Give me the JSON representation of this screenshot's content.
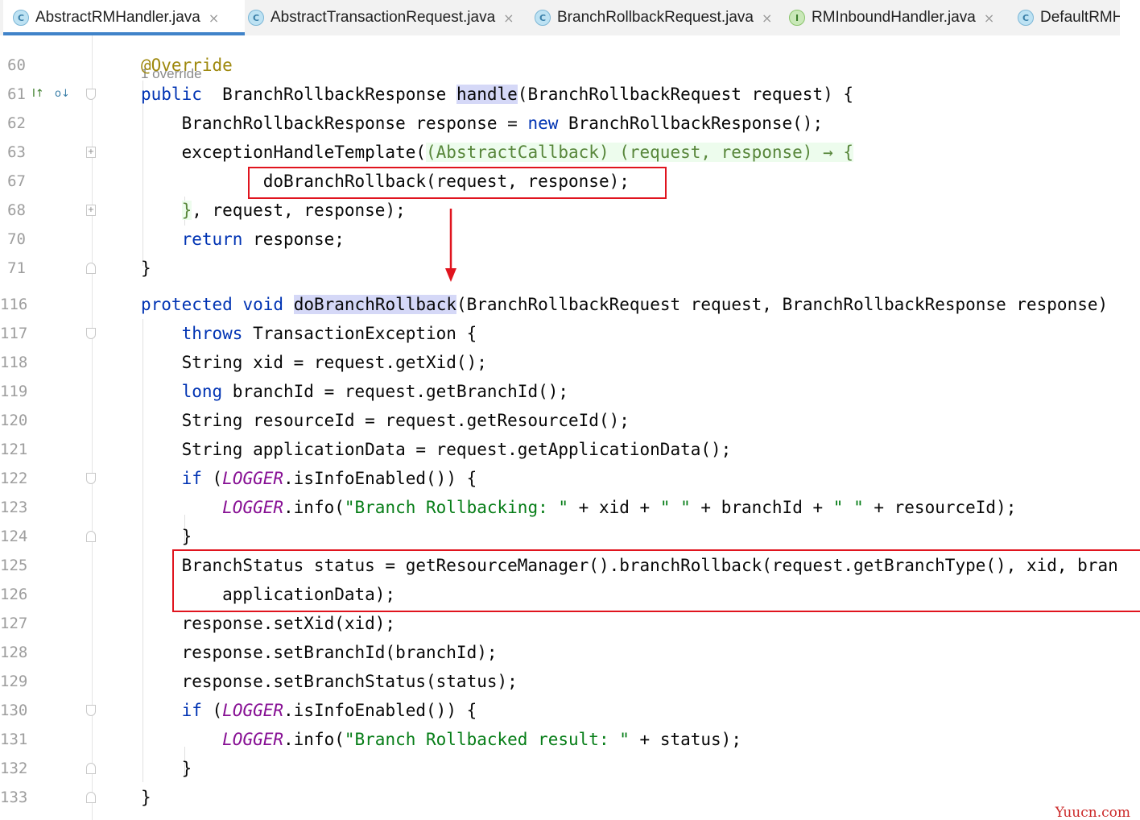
{
  "tabs": [
    {
      "label": "AbstractRMHandler.java",
      "type": "C",
      "active": true,
      "closable": true
    },
    {
      "label": "AbstractTransactionRequest.java",
      "type": "C",
      "active": false,
      "closable": true
    },
    {
      "label": "BranchRollbackRequest.java",
      "type": "C",
      "active": false,
      "closable": true
    },
    {
      "label": "RMInboundHandler.java",
      "type": "I",
      "active": false,
      "closable": true
    },
    {
      "label": "DefaultRMH",
      "type": "C",
      "active": false,
      "closable": false
    }
  ],
  "usage_hint": "1 override",
  "lines": [
    {
      "n": "60",
      "fold": "",
      "code": [
        [
          "an",
          "@Override"
        ]
      ]
    },
    {
      "n": "61",
      "fold": "down",
      "code": [
        [
          "kw",
          "public"
        ],
        [
          "",
          "  BranchRollbackResponse "
        ],
        [
          "hl",
          "handle"
        ],
        [
          "",
          "(BranchRollbackRequest request) {"
        ]
      ]
    },
    {
      "n": "62",
      "fold": "",
      "code": [
        [
          "",
          "    BranchRollbackResponse response = "
        ],
        [
          "kw",
          "new"
        ],
        [
          "",
          " BranchRollbackResponse();"
        ]
      ]
    },
    {
      "n": "63",
      "fold": "plus",
      "code": [
        [
          "",
          "    exceptionHandleTemplate("
        ],
        [
          "lamt",
          "(AbstractCallback) (request, response) → {"
        ]
      ]
    },
    {
      "n": "67",
      "fold": "",
      "code": [
        [
          "",
          "            doBranchRollback(request, response);"
        ]
      ]
    },
    {
      "n": "68",
      "fold": "plus",
      "code": [
        [
          "",
          "    "
        ],
        [
          "lamt",
          "}"
        ],
        [
          "",
          ", request, response);"
        ]
      ]
    },
    {
      "n": "70",
      "fold": "",
      "code": [
        [
          "",
          "    "
        ],
        [
          "kw",
          "return"
        ],
        [
          "",
          " response;"
        ]
      ]
    },
    {
      "n": "71",
      "fold": "up",
      "code": [
        [
          "",
          "}"
        ]
      ]
    },
    {
      "n": "116",
      "fold": "",
      "code": [
        [
          "kw",
          "protected"
        ],
        [
          "",
          " "
        ],
        [
          "kw",
          "void"
        ],
        [
          "",
          " "
        ],
        [
          "hl",
          "doBranchRollback"
        ],
        [
          "",
          "(BranchRollbackRequest request, BranchRollbackResponse response)"
        ]
      ]
    },
    {
      "n": "117",
      "fold": "down",
      "code": [
        [
          "",
          "    "
        ],
        [
          "kw",
          "throws"
        ],
        [
          "",
          " TransactionException {"
        ]
      ]
    },
    {
      "n": "118",
      "fold": "",
      "code": [
        [
          "",
          "    String xid = request.getXid();"
        ]
      ]
    },
    {
      "n": "119",
      "fold": "",
      "code": [
        [
          "",
          "    "
        ],
        [
          "kw",
          "long"
        ],
        [
          "",
          " branchId = request.getBranchId();"
        ]
      ]
    },
    {
      "n": "120",
      "fold": "",
      "code": [
        [
          "",
          "    String resourceId = request.getResourceId();"
        ]
      ]
    },
    {
      "n": "121",
      "fold": "",
      "code": [
        [
          "",
          "    String applicationData = request.getApplicationData();"
        ]
      ]
    },
    {
      "n": "122",
      "fold": "down",
      "code": [
        [
          "",
          "    "
        ],
        [
          "kw",
          "if"
        ],
        [
          "",
          " ("
        ],
        [
          "fi",
          "LOGGER"
        ],
        [
          "",
          ".isInfoEnabled()) {"
        ]
      ]
    },
    {
      "n": "123",
      "fold": "",
      "code": [
        [
          "",
          "        "
        ],
        [
          "fi",
          "LOGGER"
        ],
        [
          "",
          ".info("
        ],
        [
          "st",
          "\"Branch Rollbacking: \""
        ],
        [
          "",
          " + xid + "
        ],
        [
          "st",
          "\" \""
        ],
        [
          "",
          " + branchId + "
        ],
        [
          "st",
          "\" \""
        ],
        [
          "",
          " + resourceId);"
        ]
      ]
    },
    {
      "n": "124",
      "fold": "up",
      "code": [
        [
          "",
          "    }"
        ]
      ]
    },
    {
      "n": "125",
      "fold": "",
      "code": [
        [
          "",
          "    BranchStatus status = getResourceManager().branchRollback(request.getBranchType(), xid, bran"
        ]
      ]
    },
    {
      "n": "126",
      "fold": "",
      "code": [
        [
          "",
          "        applicationData);"
        ]
      ]
    },
    {
      "n": "127",
      "fold": "",
      "code": [
        [
          "",
          "    response.setXid(xid);"
        ]
      ]
    },
    {
      "n": "128",
      "fold": "",
      "code": [
        [
          "",
          "    response.setBranchId(branchId);"
        ]
      ]
    },
    {
      "n": "129",
      "fold": "",
      "code": [
        [
          "",
          "    response.setBranchStatus(status);"
        ]
      ]
    },
    {
      "n": "130",
      "fold": "down",
      "code": [
        [
          "",
          "    "
        ],
        [
          "kw",
          "if"
        ],
        [
          "",
          " ("
        ],
        [
          "fi",
          "LOGGER"
        ],
        [
          "",
          ".isInfoEnabled()) {"
        ]
      ]
    },
    {
      "n": "131",
      "fold": "",
      "code": [
        [
          "",
          "        "
        ],
        [
          "fi",
          "LOGGER"
        ],
        [
          "",
          ".info("
        ],
        [
          "st",
          "\"Branch Rollbacked result: \""
        ],
        [
          "",
          " + status);"
        ]
      ]
    },
    {
      "n": "132",
      "fold": "up",
      "code": [
        [
          "",
          "    }"
        ]
      ]
    },
    {
      "n": "133",
      "fold": "up",
      "code": [
        [
          "",
          "}"
        ]
      ]
    }
  ],
  "gutter_icons": {
    "implements_icon": "I↑",
    "overridden_icon": "o↓"
  },
  "watermark": "Yuucn.com",
  "colors": {
    "keyword": "#0033b3",
    "string": "#067d17",
    "annotation": "#9e880d",
    "field": "#871094",
    "highlight": "#d5d8f7",
    "annotation_box": "#e0141e",
    "arrow": "#e0141e"
  }
}
